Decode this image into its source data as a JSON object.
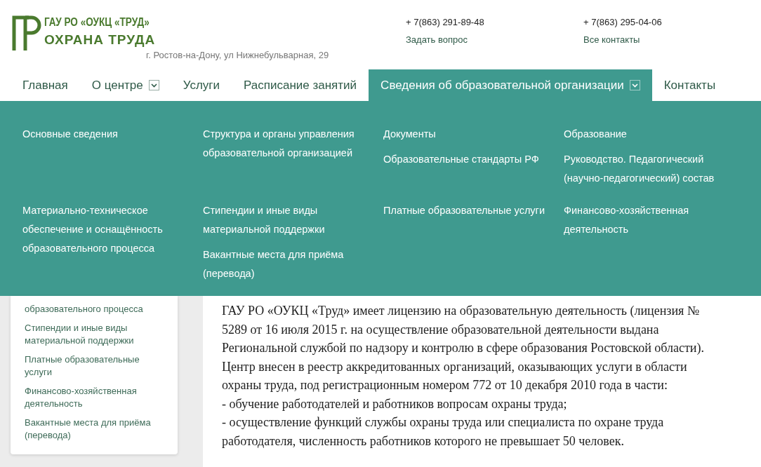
{
  "header": {
    "org_name": "ГАУ РО «ОУКЦ «ТРУД»",
    "org_tagline": "ОХРАНА ТРУДА",
    "address": "г. Ростов-на-Дону, ул Нижнебульварная, 29",
    "contacts": [
      {
        "phone": "+ 7(863) 291-89-48",
        "link": "Задать вопрос"
      },
      {
        "phone": "+ 7(863) 295-04-06",
        "link": "Все контакты"
      }
    ]
  },
  "nav": [
    {
      "label": "Главная",
      "selected": false,
      "dropdown": false
    },
    {
      "label": "О центре",
      "selected": false,
      "dropdown": true
    },
    {
      "label": "Услуги",
      "selected": false,
      "dropdown": false
    },
    {
      "label": "Расписание занятий",
      "selected": false,
      "dropdown": false
    },
    {
      "label": "Сведения об образовательной организации",
      "selected": true,
      "dropdown": true
    },
    {
      "label": "Контакты",
      "selected": false,
      "dropdown": false
    }
  ],
  "mega_menu": {
    "rows": [
      [
        [
          "Основные сведения"
        ],
        [
          "Структура и органы управления образовательной организацией"
        ],
        [
          "Документы",
          "Образовательные стандарты РФ"
        ],
        [
          "Образование",
          "Руководство. Педагогический (научно-педагогический) состав"
        ]
      ],
      [
        [
          "Материально-техническое обеспечение и оснащённость образовательного процесса"
        ],
        [
          "Стипендии и иные виды материальной поддержки",
          "Вакантные места для приёма (перевода)"
        ],
        [
          "Платные образовательные услуги"
        ],
        [
          "Финансово-хозяйственная деятельность"
        ]
      ]
    ]
  },
  "sidebar": {
    "items": [
      "образовательного процесса",
      "Стипендии и иные виды материальной поддержки",
      "Платные образовательные услуги",
      "Финансово-хозяйственная деятельность",
      "Вакантные места для приёма (перевода)"
    ]
  },
  "content": {
    "paragraphs": [
      "ГАУ РО «ОУКЦ «Труд» имеет лицензию на образовательную деятельность (лицензия № 5289 от 16 июля 2015 г. на осуществление образовательной деятельности выдана Региональной службой по надзору и контролю в сфере образования Ростовской области).",
      "Центр внесен в реестр аккредитованных организаций, оказывающих услуги в области охраны труда, под регистрационным номером 772 от 10 декабря 2010 года в части:",
      "- обучение работодателей и работников вопросам охраны труда;",
      "- осуществление функций службы охраны труда или специалиста по охране труда работодателя, численность работников которого не превышает 50 человек."
    ]
  }
}
